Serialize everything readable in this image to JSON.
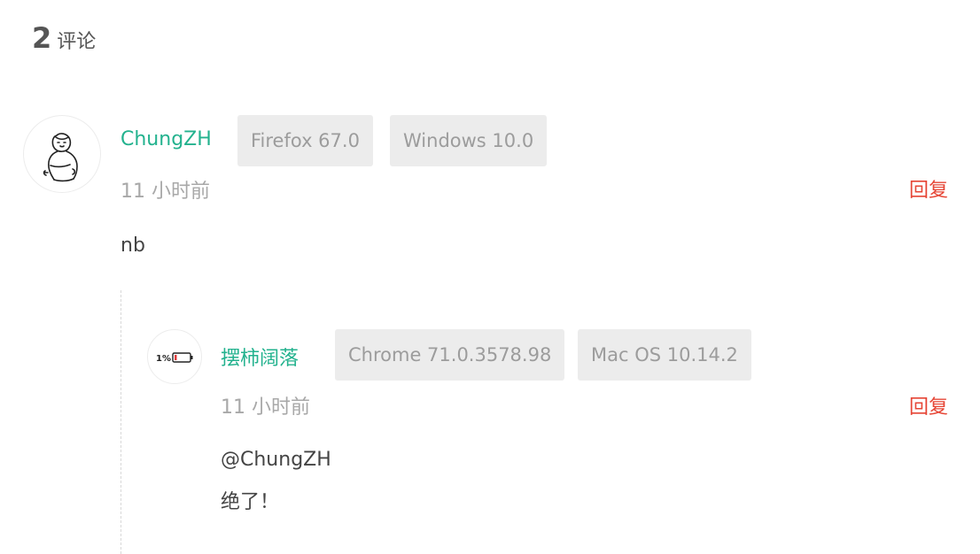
{
  "header": {
    "count": "2",
    "label": "评论"
  },
  "comments": [
    {
      "author": "ChungZH",
      "browser": "Firefox 67.0",
      "os": "Windows 10.0",
      "time": "11 小时前",
      "reply_label": "回复",
      "content": [
        "nb"
      ],
      "avatar_icon": "sketch-person-avatar"
    },
    {
      "author": "摆柿阔落",
      "browser": "Chrome 71.0.3578.98",
      "os": "Mac OS 10.14.2",
      "time": "11 小时前",
      "reply_label": "回复",
      "content": [
        "@ChungZH",
        "绝了！"
      ],
      "avatar_icon": "low-battery-avatar",
      "avatar_text": "1%"
    }
  ],
  "colors": {
    "author": "#23b28e",
    "reply": "#e64535",
    "badge_bg": "#ececec",
    "badge_text": "#9c9c9c",
    "battery_red": "#e03a3a"
  }
}
